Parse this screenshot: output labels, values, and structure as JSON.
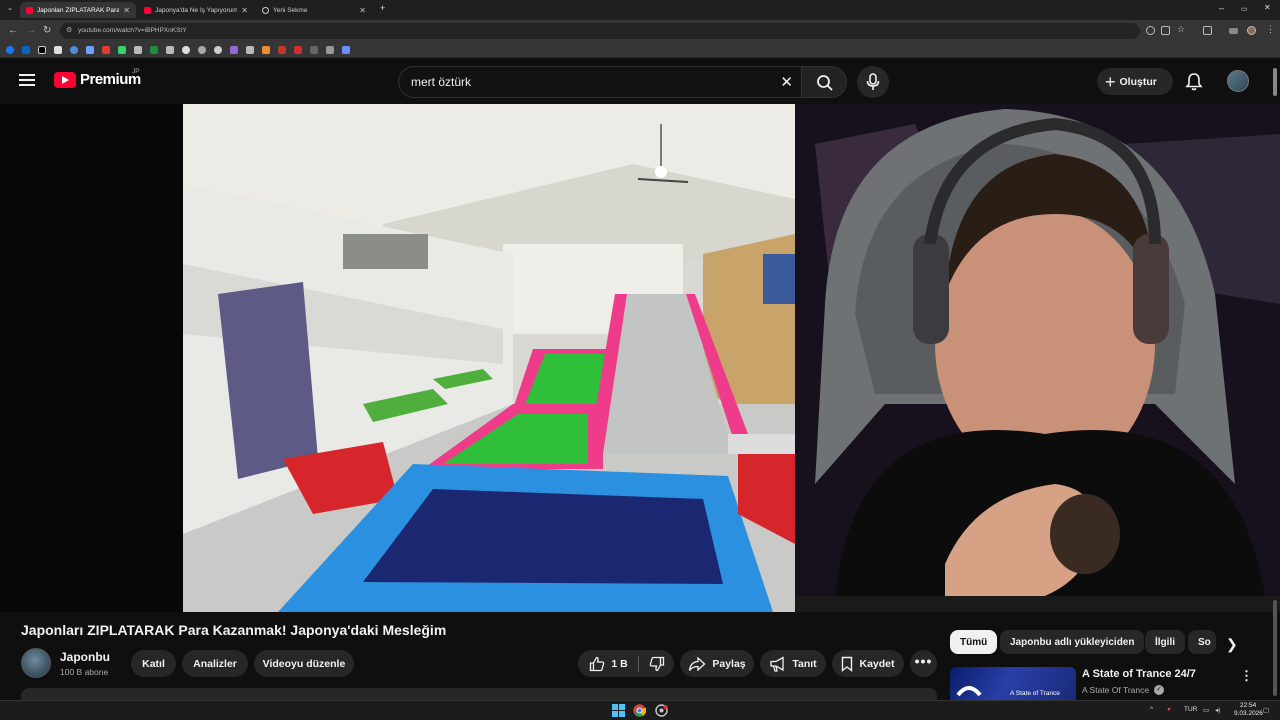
{
  "browser": {
    "tabs": [
      {
        "title": "Japonları ZIPLATARAK Para Kaza",
        "active": true
      },
      {
        "title": "Japonya'da Ne İş Yapıyorum? I",
        "active": false
      },
      {
        "title": "Yeni Sekme",
        "active": false
      }
    ],
    "new_tab": "+",
    "window_controls": [
      "–",
      "▭",
      "✕"
    ],
    "url": "youtube.com/watch?v=iBPHPXnKStY"
  },
  "header": {
    "logo_text": "Premium",
    "logo_region": "JP",
    "search_value": "mert öztürk",
    "create_label": "Oluştur"
  },
  "video": {
    "title": "Japonları ZIPLATARAK Para Kazanmak! Japonya'daki Mesleğim",
    "channel": {
      "name": "Japonbu",
      "subscribers": "100 B abone"
    },
    "buttons": {
      "join": "Katıl",
      "analytics": "Analizler",
      "edit": "Videoyu düzenle",
      "likes": "1 B",
      "share": "Paylaş",
      "promote": "Tanıt",
      "save": "Kaydet",
      "more": "•••"
    }
  },
  "sidebar": {
    "chips": [
      "Tümü",
      "Japonbu adlı yükleyiciden",
      "İlgili",
      "So"
    ],
    "recommendation": {
      "title": "A State of Trance 24/7",
      "channel": "A State Of Trance",
      "thumb_text": "A State of Trance",
      "menu": "⋮"
    }
  },
  "taskbar": {
    "lang": "TUR",
    "time": "22:54",
    "date": "9.03.2026"
  },
  "colors": {
    "bg": "#0f0f0f",
    "brand_red": "#ff0033",
    "pill": "#272727",
    "text": "#f1f1f1",
    "muted": "#aaaaaa"
  }
}
